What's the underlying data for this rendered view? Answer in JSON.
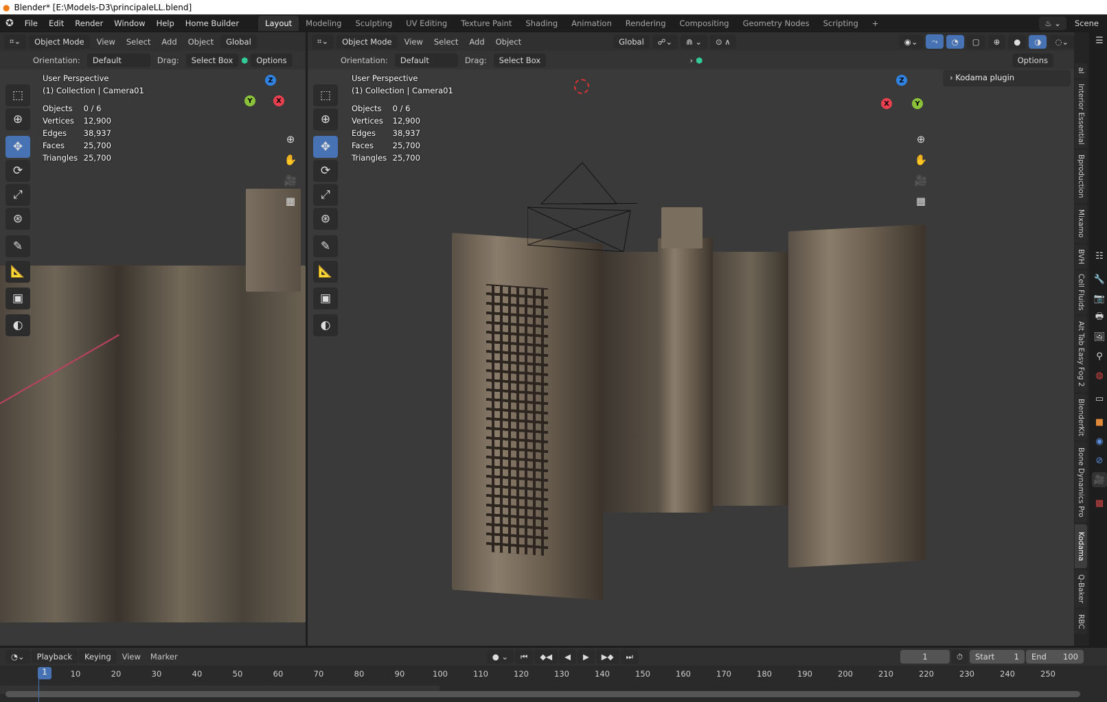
{
  "window_title": "Blender* [E:\\Models-D3\\principaleLL.blend]",
  "menus": [
    "File",
    "Edit",
    "Render",
    "Window",
    "Help",
    "Home Builder"
  ],
  "workspaces": [
    "Layout",
    "Modeling",
    "Sculpting",
    "UV Editing",
    "Texture Paint",
    "Shading",
    "Animation",
    "Rendering",
    "Compositing",
    "Geometry Nodes",
    "Scripting"
  ],
  "active_workspace": "Layout",
  "scene": "Scene",
  "viewport": {
    "mode": "Object Mode",
    "view": "View",
    "select": "Select",
    "add": "Add",
    "object": "Object",
    "transform": "Global",
    "orientation_label": "Orientation:",
    "orientation": "Default",
    "drag_label": "Drag:",
    "drag": "Select Box",
    "options": "Options",
    "perspective": "User Perspective",
    "collection": "(1) Collection | Camera01",
    "stats": [
      {
        "k": "Objects",
        "v": "0 / 6"
      },
      {
        "k": "Vertices",
        "v": "12,900"
      },
      {
        "k": "Edges",
        "v": "38,937"
      },
      {
        "k": "Faces",
        "v": "25,700"
      },
      {
        "k": "Triangles",
        "v": "25,700"
      }
    ]
  },
  "axes": {
    "x": "X",
    "y": "Y",
    "z": "Z"
  },
  "npanel": {
    "panel": "Kodama plugin",
    "tabs": [
      "al",
      "Interior Essential",
      "Bproduction",
      "Mixamo",
      "BVH",
      "Cell Fluids",
      "Alt Tab Easy Fog 2",
      "BlenderKit",
      "Bone Dynamics Pro",
      "Kodama",
      "Q-Baker",
      "RBC"
    ],
    "active_tab": "Kodama"
  },
  "timeline": {
    "menus": [
      "Playback",
      "Keying",
      "View",
      "Marker"
    ],
    "current_frame": "1",
    "start_label": "Start",
    "start": "1",
    "end_label": "End",
    "end": "100",
    "ticks": [
      "10",
      "20",
      "30",
      "40",
      "50",
      "60",
      "70",
      "80",
      "90",
      "100",
      "110",
      "120",
      "130",
      "140",
      "150",
      "160",
      "170",
      "180",
      "190",
      "200",
      "210",
      "220",
      "230",
      "240",
      "250"
    ]
  },
  "colors": {
    "accent": "#4772b3",
    "x": "#e9404f",
    "y": "#8bc23c",
    "z": "#2f83e3"
  }
}
